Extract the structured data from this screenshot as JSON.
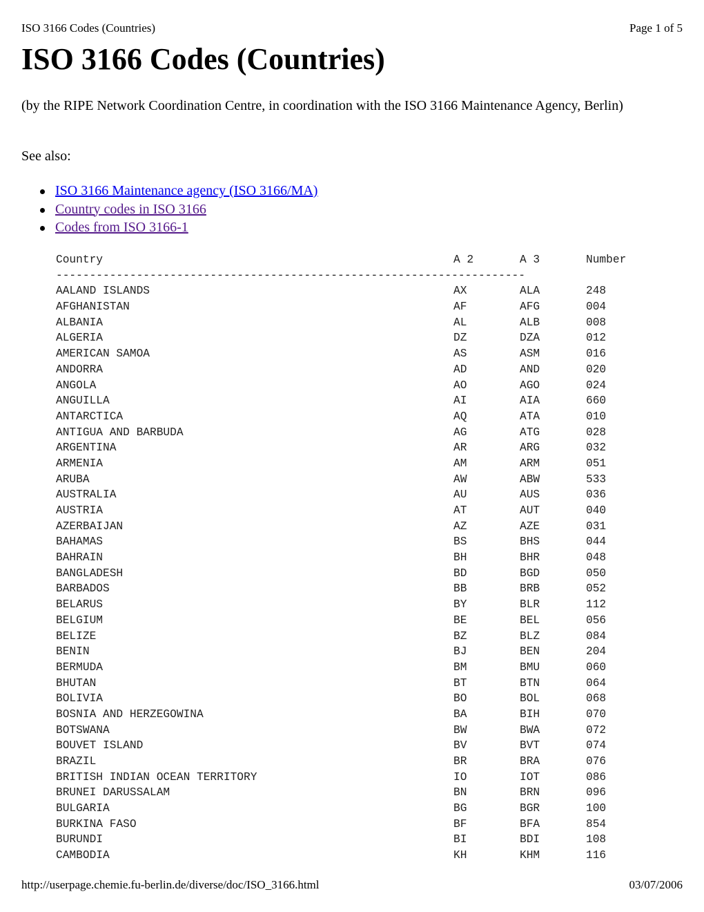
{
  "print_header": {
    "title": "ISO 3166 Codes (Countries)",
    "page": "Page 1 of 5"
  },
  "heading": "ISO 3166 Codes (Countries)",
  "intro": "(by the RIPE Network Coordination Centre, in coordination with the ISO 3166 Maintenance Agency, Berlin)",
  "see_also_label": "See also:",
  "links": [
    {
      "label": "ISO 3166 Maintenance agency (ISO 3166/MA)",
      "state": "unvisited"
    },
    {
      "label": "Country codes in ISO 3166",
      "state": "visited"
    },
    {
      "label": "Codes from ISO 3166-1",
      "state": "visited"
    }
  ],
  "link_colors": {
    "unvisited": "#0000ee",
    "visited": "#551a8b"
  },
  "table": {
    "headers": {
      "country": "Country",
      "a2": "A 2",
      "a3": "A 3",
      "number": "Number"
    },
    "rule": "----------------------------------------------------------------------",
    "rows": [
      {
        "country": "AALAND ISLANDS",
        "a2": "AX",
        "a3": "ALA",
        "number": "248"
      },
      {
        "country": "AFGHANISTAN",
        "a2": "AF",
        "a3": "AFG",
        "number": "004"
      },
      {
        "country": "ALBANIA",
        "a2": "AL",
        "a3": "ALB",
        "number": "008"
      },
      {
        "country": "ALGERIA",
        "a2": "DZ",
        "a3": "DZA",
        "number": "012"
      },
      {
        "country": "AMERICAN SAMOA",
        "a2": "AS",
        "a3": "ASM",
        "number": "016"
      },
      {
        "country": "ANDORRA",
        "a2": "AD",
        "a3": "AND",
        "number": "020"
      },
      {
        "country": "ANGOLA",
        "a2": "AO",
        "a3": "AGO",
        "number": "024"
      },
      {
        "country": "ANGUILLA",
        "a2": "AI",
        "a3": "AIA",
        "number": "660"
      },
      {
        "country": "ANTARCTICA",
        "a2": "AQ",
        "a3": "ATA",
        "number": "010"
      },
      {
        "country": "ANTIGUA AND BARBUDA",
        "a2": "AG",
        "a3": "ATG",
        "number": "028"
      },
      {
        "country": "ARGENTINA",
        "a2": "AR",
        "a3": "ARG",
        "number": "032"
      },
      {
        "country": "ARMENIA",
        "a2": "AM",
        "a3": "ARM",
        "number": "051"
      },
      {
        "country": "ARUBA",
        "a2": "AW",
        "a3": "ABW",
        "number": "533"
      },
      {
        "country": "AUSTRALIA",
        "a2": "AU",
        "a3": "AUS",
        "number": "036"
      },
      {
        "country": "AUSTRIA",
        "a2": "AT",
        "a3": "AUT",
        "number": "040"
      },
      {
        "country": "AZERBAIJAN",
        "a2": "AZ",
        "a3": "AZE",
        "number": "031"
      },
      {
        "country": "BAHAMAS",
        "a2": "BS",
        "a3": "BHS",
        "number": "044"
      },
      {
        "country": "BAHRAIN",
        "a2": "BH",
        "a3": "BHR",
        "number": "048"
      },
      {
        "country": "BANGLADESH",
        "a2": "BD",
        "a3": "BGD",
        "number": "050"
      },
      {
        "country": "BARBADOS",
        "a2": "BB",
        "a3": "BRB",
        "number": "052"
      },
      {
        "country": "BELARUS",
        "a2": "BY",
        "a3": "BLR",
        "number": "112"
      },
      {
        "country": "BELGIUM",
        "a2": "BE",
        "a3": "BEL",
        "number": "056"
      },
      {
        "country": "BELIZE",
        "a2": "BZ",
        "a3": "BLZ",
        "number": "084"
      },
      {
        "country": "BENIN",
        "a2": "BJ",
        "a3": "BEN",
        "number": "204"
      },
      {
        "country": "BERMUDA",
        "a2": "BM",
        "a3": "BMU",
        "number": "060"
      },
      {
        "country": "BHUTAN",
        "a2": "BT",
        "a3": "BTN",
        "number": "064"
      },
      {
        "country": "BOLIVIA",
        "a2": "BO",
        "a3": "BOL",
        "number": "068"
      },
      {
        "country": "BOSNIA AND HERZEGOWINA",
        "a2": "BA",
        "a3": "BIH",
        "number": "070"
      },
      {
        "country": "BOTSWANA",
        "a2": "BW",
        "a3": "BWA",
        "number": "072"
      },
      {
        "country": "BOUVET ISLAND",
        "a2": "BV",
        "a3": "BVT",
        "number": "074"
      },
      {
        "country": "BRAZIL",
        "a2": "BR",
        "a3": "BRA",
        "number": "076"
      },
      {
        "country": "BRITISH INDIAN OCEAN TERRITORY",
        "a2": "IO",
        "a3": "IOT",
        "number": "086"
      },
      {
        "country": "BRUNEI DARUSSALAM",
        "a2": "BN",
        "a3": "BRN",
        "number": "096"
      },
      {
        "country": "BULGARIA",
        "a2": "BG",
        "a3": "BGR",
        "number": "100"
      },
      {
        "country": "BURKINA FASO",
        "a2": "BF",
        "a3": "BFA",
        "number": "854"
      },
      {
        "country": "BURUNDI",
        "a2": "BI",
        "a3": "BDI",
        "number": "108"
      },
      {
        "country": "CAMBODIA",
        "a2": "KH",
        "a3": "KHM",
        "number": "116"
      }
    ]
  },
  "print_footer": {
    "url": "http://userpage.chemie.fu-berlin.de/diverse/doc/ISO_3166.html",
    "date": "03/07/2006"
  }
}
